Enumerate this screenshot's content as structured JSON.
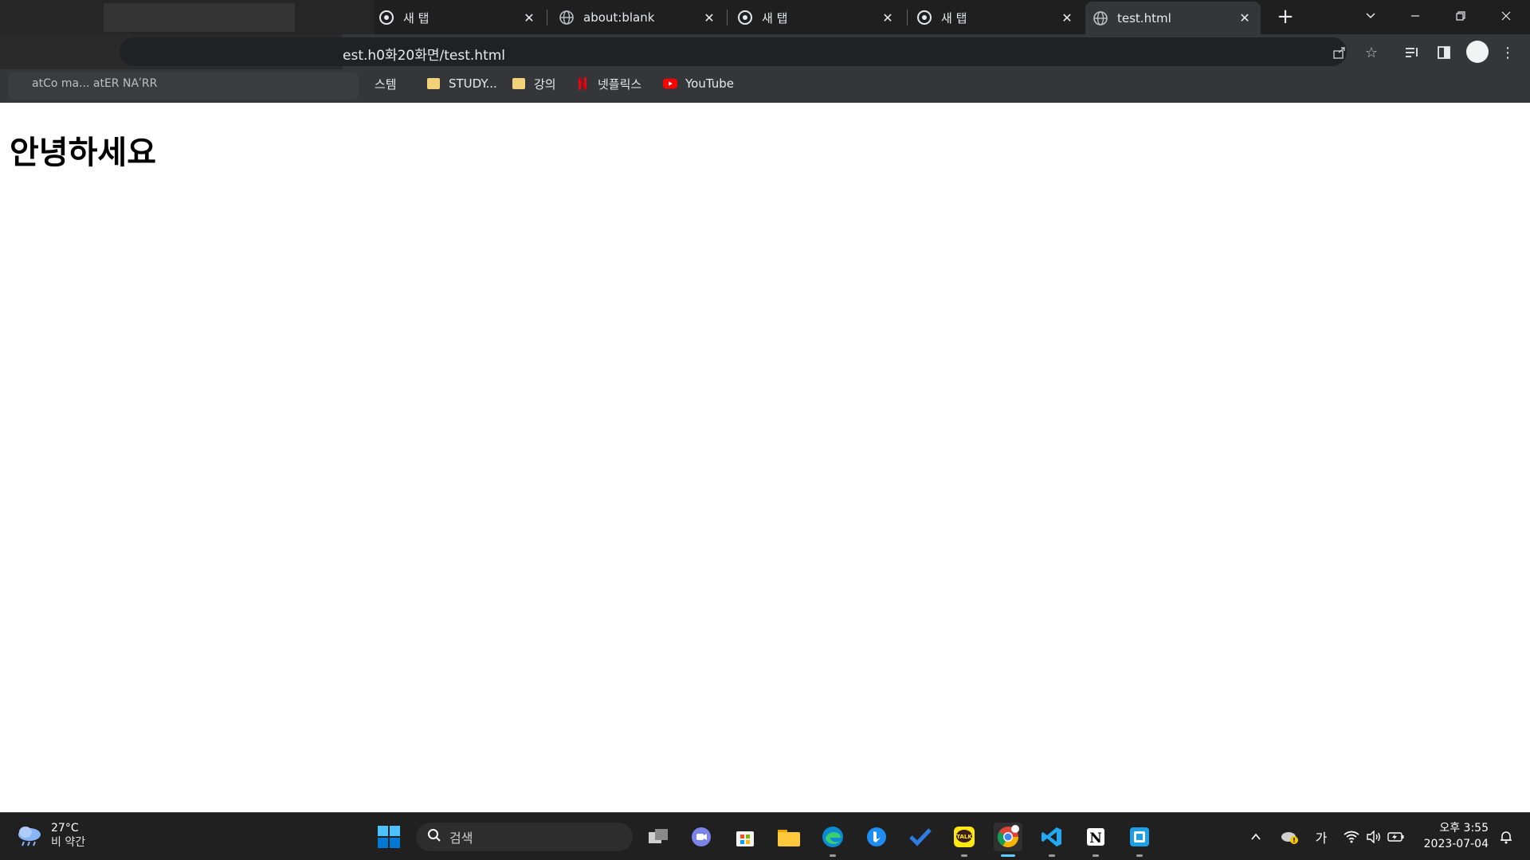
{
  "browser": {
    "tabs": [
      {
        "title": "새 탭",
        "favicon": "chrome-icon",
        "active": false
      },
      {
        "title": "about:blank",
        "favicon": "globe-icon",
        "active": false
      },
      {
        "title": "새 탭",
        "favicon": "chrome-icon",
        "active": false
      },
      {
        "title": "새 탭",
        "favicon": "chrome-icon",
        "active": false
      },
      {
        "title": "test.html",
        "favicon": "globe-icon",
        "active": true
      }
    ],
    "new_tab_label": "+",
    "url": "est.h0화20화면/test.html",
    "bookmarks": [
      {
        "label": "스템",
        "icon": "none"
      },
      {
        "label": "STUDY...",
        "icon": "folder-icon"
      },
      {
        "label": "강의",
        "icon": "folder-icon"
      },
      {
        "label": "넷플릭스",
        "icon": "netflix-icon"
      },
      {
        "label": "YouTube",
        "icon": "youtube-icon"
      }
    ],
    "partial_bookmarks_text": "atϹo ma... atЕR NAʹRR"
  },
  "page": {
    "heading": "안녕하세요"
  },
  "taskbar": {
    "weather": {
      "temp": "27°C",
      "condition": "비 약간"
    },
    "search_placeholder": "검색",
    "ime_label": "가",
    "clock": {
      "time": "오후 3:55",
      "date": "2023-07-04"
    }
  },
  "colors": {
    "tabstrip": "#1f1f1f",
    "toolbar": "#35363a",
    "taskbar": "#202020",
    "accent": "#60cdff"
  }
}
